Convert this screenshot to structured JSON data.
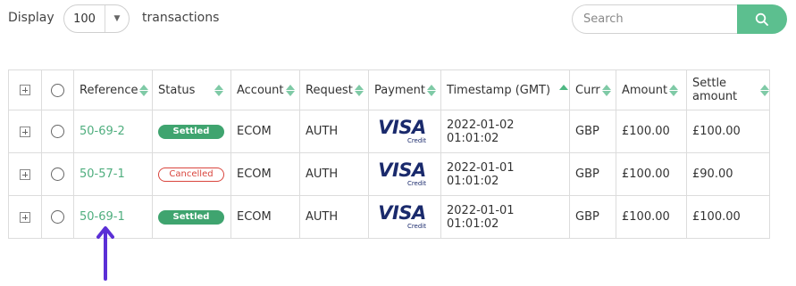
{
  "toolbar": {
    "display_label": "Display",
    "page_size_value": "100",
    "transactions_label": "transactions",
    "search_placeholder": "Search"
  },
  "table": {
    "columns": [
      "Reference",
      "Status",
      "Account",
      "Request",
      "Payment",
      "Timestamp (GMT)",
      "Curr",
      "Amount",
      "Settle amount"
    ],
    "rows": [
      {
        "reference": "50-69-2",
        "status": "Settled",
        "account": "ECOM",
        "request": "AUTH",
        "payment_brand": "VISA",
        "payment_type": "Credit",
        "timestamp": "2022-01-02 01:01:02",
        "currency": "GBP",
        "amount": "£100.00",
        "settle_amount": "£100.00"
      },
      {
        "reference": "50-57-1",
        "status": "Cancelled",
        "account": "ECOM",
        "request": "AUTH",
        "payment_brand": "VISA",
        "payment_type": "Credit",
        "timestamp": "2022-01-01 01:01:02",
        "currency": "GBP",
        "amount": "£100.00",
        "settle_amount": "£90.00"
      },
      {
        "reference": "50-69-1",
        "status": "Settled",
        "account": "ECOM",
        "request": "AUTH",
        "payment_brand": "VISA",
        "payment_type": "Credit",
        "timestamp": "2022-01-01 01:01:02",
        "currency": "GBP",
        "amount": "£100.00",
        "settle_amount": "£100.00"
      }
    ]
  },
  "colors": {
    "accent_green": "#5cbf8f",
    "link_green": "#4fae7e",
    "settled_badge": "#3fa46f",
    "cancelled_badge": "#d9453d",
    "arrow": "#5b2fd6",
    "visa_navy": "#1a2a6c"
  },
  "icons": {
    "search": "search-icon",
    "dropdown": "chevron-down-icon",
    "expand": "plus-square-icon",
    "select": "radio-icon",
    "sort": "sort-icon",
    "annotation": "arrow-up-icon"
  }
}
